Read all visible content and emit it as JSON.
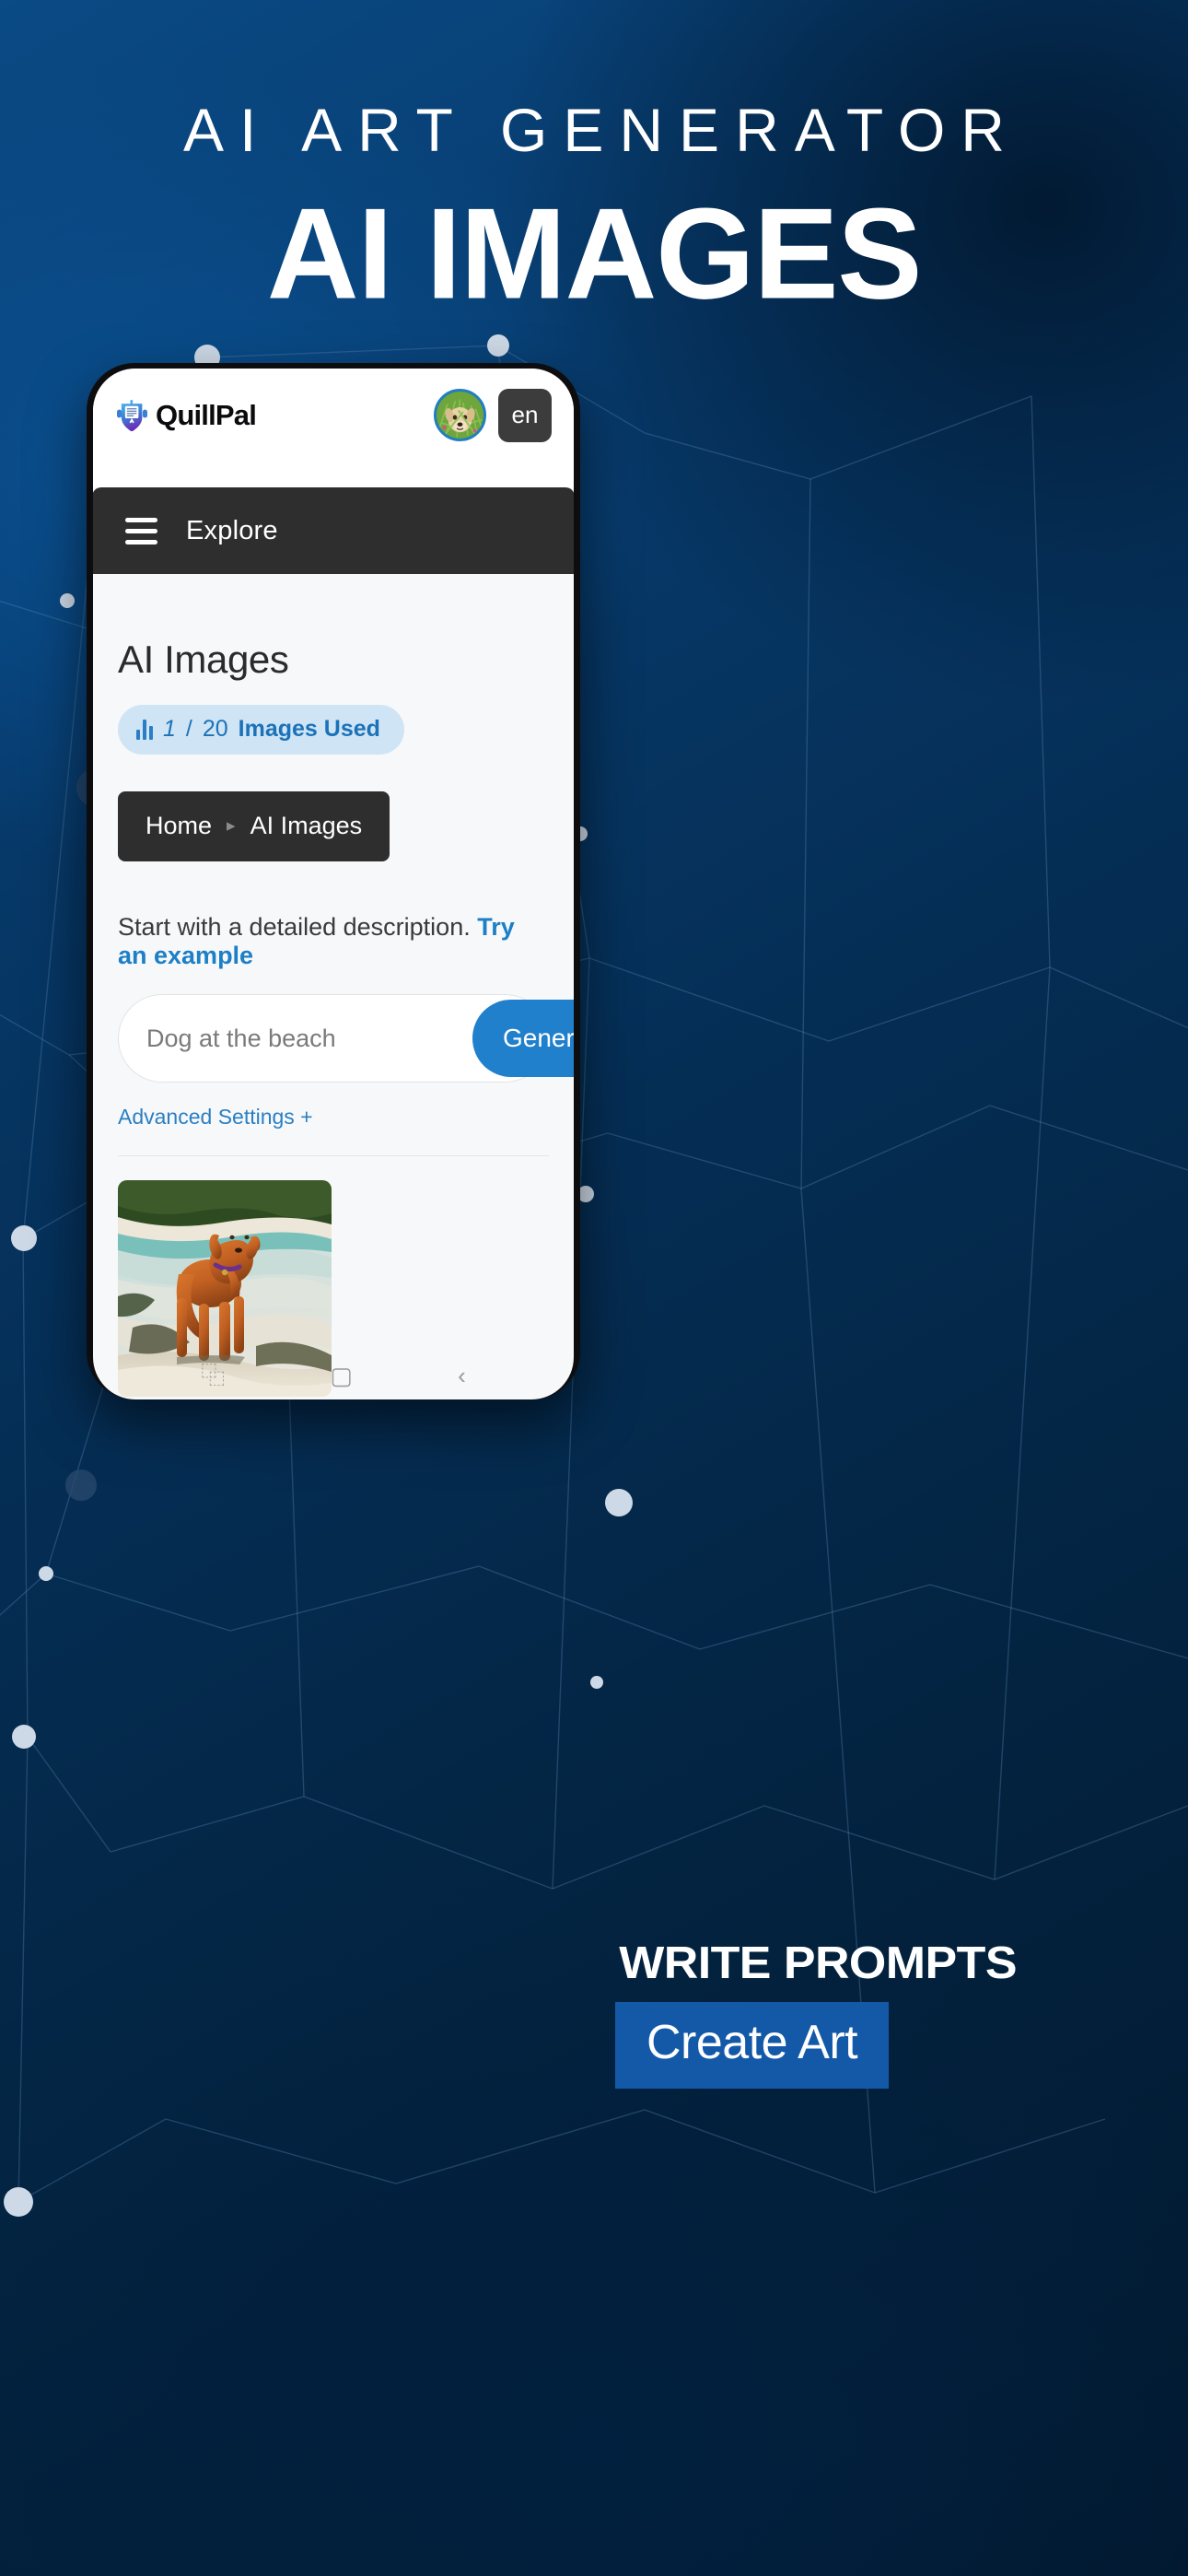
{
  "hero": {
    "kicker": "AI ART GENERATOR",
    "title": "AI IMAGES"
  },
  "colors": {
    "background_top": "#0a4a85",
    "background_bottom": "#02182e",
    "accent_blue": "#2180cc",
    "link_blue": "#1c7fc7",
    "dark_bar": "#2e2e2e",
    "pill_bg": "#cfe4f5",
    "promo_box": "#1459a8"
  },
  "app": {
    "header": {
      "brand_name": "QuillPal",
      "brand_icon": "quillpal-shield-robot-icon",
      "avatar_icon": "puppy-avatar",
      "language": "en"
    },
    "explore": {
      "menu_icon": "hamburger-menu-icon",
      "label": "Explore"
    },
    "page": {
      "title": "AI Images",
      "usage": {
        "icon": "bar-chart-icon",
        "used": "1",
        "separator": "/",
        "total": "20",
        "label": "Images Used"
      },
      "breadcrumb": {
        "home": "Home",
        "separator": "▸",
        "current": "AI Images"
      },
      "description": {
        "text": "Start with a detailed description.",
        "link": "Try an example"
      },
      "prompt": {
        "placeholder": "Dog at the beach",
        "value": "",
        "generate_label": "Generate",
        "generate_icon": "arrow-right-icon"
      },
      "advanced_settings": "Advanced Settings +",
      "result_image_alt": "dog-at-the-beach-result"
    },
    "nav_hints": {
      "recents": "⿻",
      "home": "▢",
      "back": "‹"
    }
  },
  "promo": {
    "line1": "WRITE PROMPTS",
    "line2": "Create Art"
  }
}
